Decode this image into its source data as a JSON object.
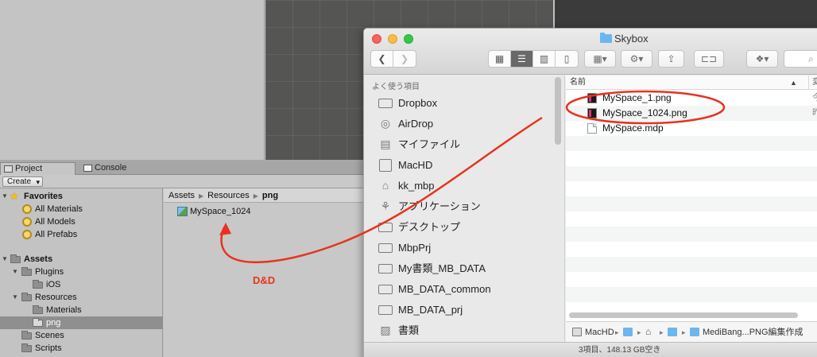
{
  "unity": {
    "tabs": [
      {
        "label": "Project",
        "active": true
      },
      {
        "label": "Console",
        "active": false
      }
    ],
    "toolbar": {
      "create_label": "Create"
    },
    "tree": {
      "favorites_label": "Favorites",
      "favorites": [
        "All Materials",
        "All Models",
        "All Prefabs"
      ],
      "assets_label": "Assets",
      "plugins_label": "Plugins",
      "ios_label": "iOS",
      "resources_label": "Resources",
      "materials_label": "Materials",
      "png_label": "png",
      "scenes_label": "Scenes",
      "scripts_label": "Scripts"
    },
    "breadcrumb": [
      "Assets",
      "Resources",
      "png"
    ],
    "assets": [
      "MySpace_1024"
    ]
  },
  "finder": {
    "title": "Skybox",
    "sidebar_header": "よく使う項目",
    "sidebar_items": [
      {
        "label": "Dropbox",
        "icon": "folder-icon"
      },
      {
        "label": "AirDrop",
        "icon": "airdrop-icon"
      },
      {
        "label": "マイファイル",
        "icon": "all-files-icon"
      },
      {
        "label": "MacHD",
        "icon": "drive-icon"
      },
      {
        "label": "kk_mbp",
        "icon": "home-icon"
      },
      {
        "label": "アプリケーション",
        "icon": "applications-icon"
      },
      {
        "label": "デスクトップ",
        "icon": "folder-icon"
      },
      {
        "label": "MbpPrj",
        "icon": "folder-icon"
      },
      {
        "label": "My書類_MB_DATA",
        "icon": "folder-icon"
      },
      {
        "label": "MB_DATA_common",
        "icon": "folder-icon"
      },
      {
        "label": "MB_DATA_prj",
        "icon": "folder-icon"
      },
      {
        "label": "書類",
        "icon": "documents-icon"
      }
    ],
    "column_name": "名前",
    "column_date_partial": "変",
    "files": [
      {
        "name": "MySpace_1.png",
        "type": "png",
        "date_partial": "今"
      },
      {
        "name": "MySpace_1024.png",
        "type": "png",
        "date_partial": "昨"
      },
      {
        "name": "MySpace.mdp",
        "type": "doc",
        "date_partial": ""
      }
    ],
    "path_bar": [
      "MacHD",
      "",
      "",
      "",
      "MediBang...PNG編集作成"
    ],
    "status": "3項目、148.13 GB空き"
  },
  "annotation": {
    "label": "D&D",
    "color": "#e8321f"
  }
}
